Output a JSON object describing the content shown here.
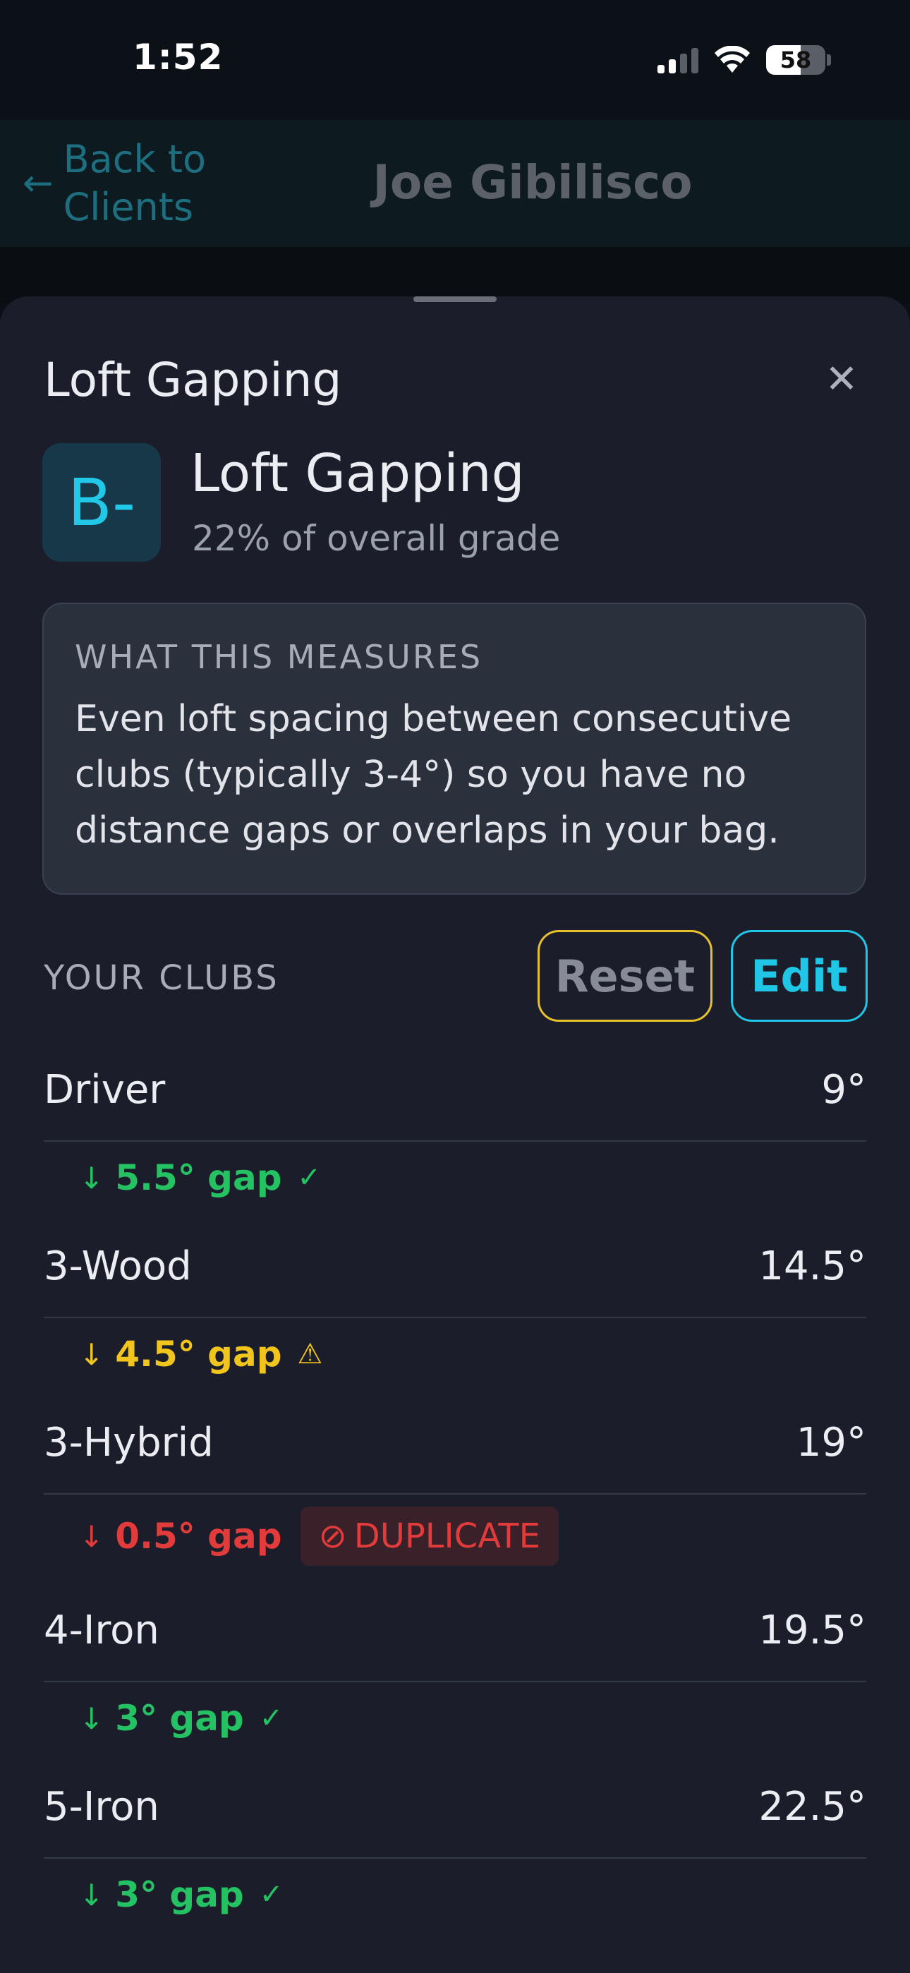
{
  "status": {
    "time": "1:52",
    "battery": "58",
    "battery_level": 0.58
  },
  "nav": {
    "back_icon": "←",
    "back_label": "Back to Clients",
    "title": "Joe Gibilisco"
  },
  "sheet": {
    "title": "Loft Gapping",
    "close_icon": "✕"
  },
  "grade": {
    "letter": "B-",
    "name": "Loft Gapping",
    "weight": "22% of overall grade"
  },
  "measures": {
    "label": "WHAT THIS MEASURES",
    "text": "Even loft spacing between consecutive clubs (typically 3-4°) so you have no distance gaps or overlaps in your bag."
  },
  "clubs_section": {
    "label": "YOUR CLUBS",
    "reset_label": "Reset",
    "edit_label": "Edit"
  },
  "clubs": [
    {
      "name": "Driver",
      "loft": "9°"
    },
    {
      "name": "3-Wood",
      "loft": "14.5°"
    },
    {
      "name": "3-Hybrid",
      "loft": "19°"
    },
    {
      "name": "4-Iron",
      "loft": "19.5°"
    },
    {
      "name": "5-Iron",
      "loft": "22.5°"
    }
  ],
  "gaps": [
    {
      "arrow": "↓",
      "text": "5.5° gap",
      "status_icon": "✓",
      "status": "good"
    },
    {
      "arrow": "↓",
      "text": "4.5° gap",
      "status_icon": "⚠",
      "status": "warn"
    },
    {
      "arrow": "↓",
      "text": "0.5° gap",
      "status": "bad",
      "badge_icon": "⊘",
      "badge_label": "DUPLICATE"
    },
    {
      "arrow": "↓",
      "text": "3° gap",
      "status_icon": "✓",
      "status": "good"
    },
    {
      "arrow": "↓",
      "text": "3° gap",
      "status_icon": "✓",
      "status": "good"
    }
  ],
  "colors": {
    "accent": "#1fc6e6",
    "good": "#25c263",
    "warn": "#f1c51c",
    "bad": "#e13b3b",
    "reset_border": "#e6c12c"
  }
}
